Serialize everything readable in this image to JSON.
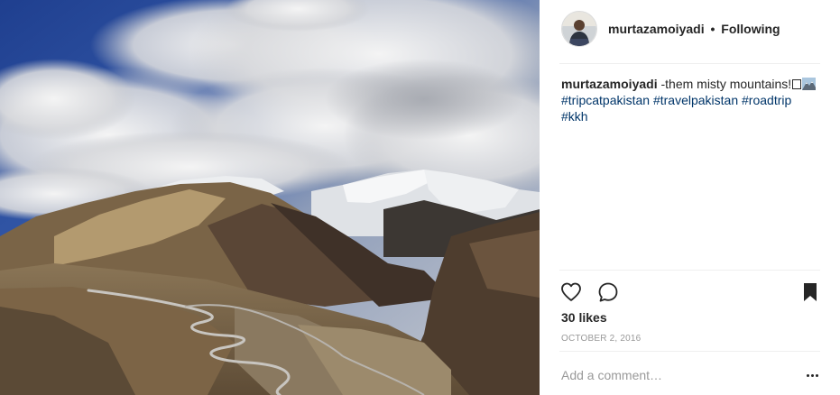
{
  "post": {
    "username": "murtazamoiyadi",
    "separator": "•",
    "follow_state": "Following",
    "caption": {
      "username": "murtazamoiyadi",
      "text": "-them misty mountains!",
      "hashtags": [
        "#tripcatpakistan",
        "#travelpakistan",
        "#roadtrip",
        "#kkh"
      ]
    },
    "likes": "30 likes",
    "date": "OCTOBER 2, 2016",
    "comment_placeholder": "Add a comment…"
  },
  "icons": {
    "like": "heart-outline-icon",
    "comment": "speech-bubble-icon",
    "save": "bookmark-filled-icon",
    "more": "more-options-icon"
  },
  "colors": {
    "text": "#262626",
    "hashtag": "#003569",
    "muted": "#999999",
    "divider": "#efefef"
  }
}
